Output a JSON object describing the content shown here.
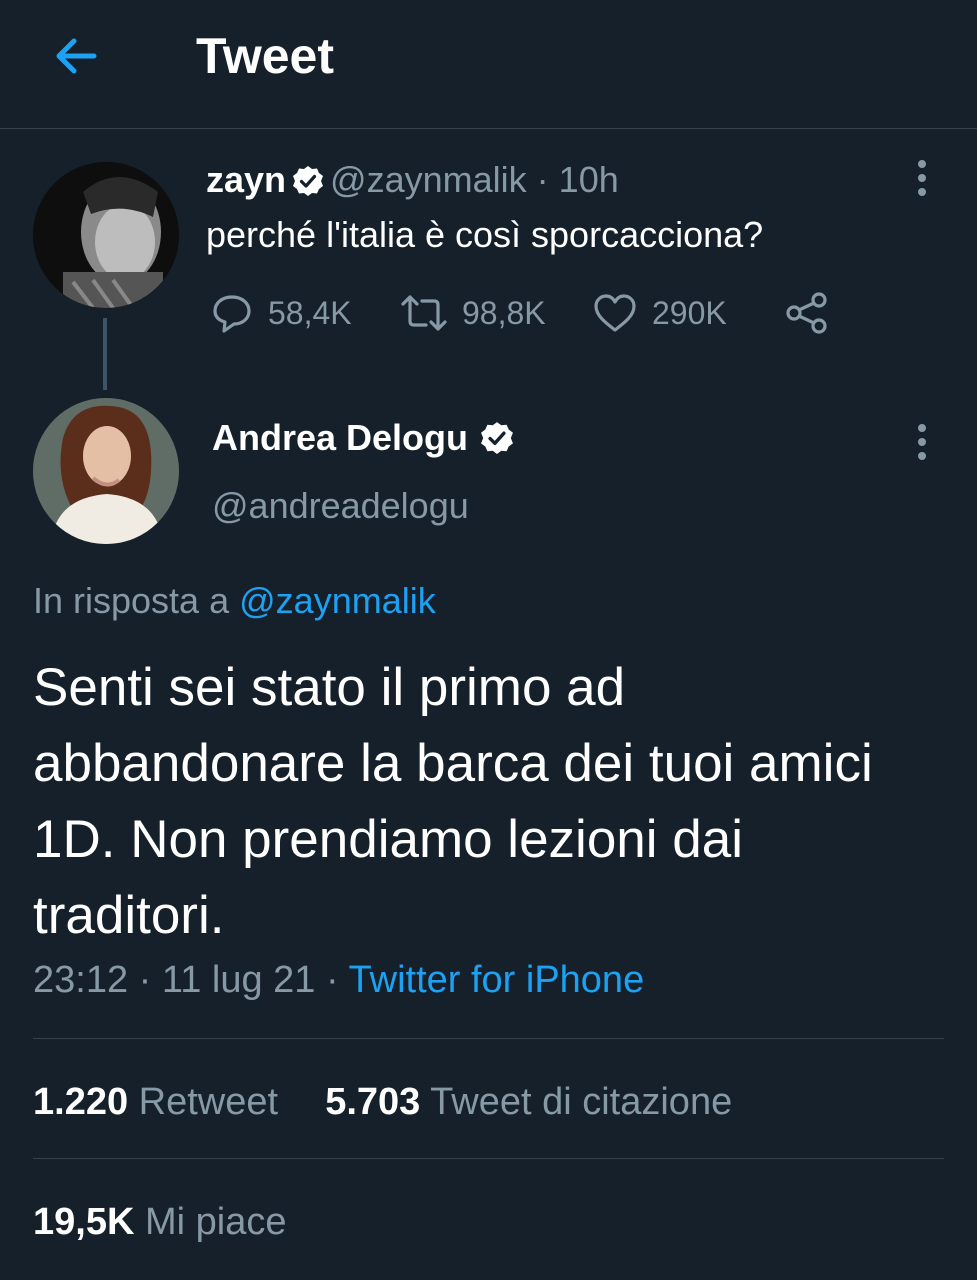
{
  "header": {
    "title": "Tweet"
  },
  "parent_tweet": {
    "name": "zayn",
    "handle": "@zaynmalik",
    "separator": "·",
    "time": "10h",
    "text": "perché l'italia è così sporcacciona?",
    "replies": "58,4K",
    "retweets": "98,8K",
    "likes": "290K"
  },
  "main_tweet": {
    "name": "Andrea Delogu",
    "handle": "@andreadelogu",
    "reply_prefix": "In risposta a",
    "reply_handle": "@zaynmalik",
    "text": "Senti sei stato il primo ad abbandonare la barca dei tuoi amici 1D. Non prendiamo lezioni dai traditori.",
    "time": "23:12",
    "sep1": "·",
    "date": "11 lug 21",
    "sep2": "·",
    "source": "Twitter for iPhone"
  },
  "stats": {
    "retweet_count": "1.220",
    "retweet_label": "Retweet",
    "quote_count": "5.703",
    "quote_label": "Tweet di citazione",
    "like_count": "19,5K",
    "like_label": "Mi piace"
  },
  "colors": {
    "background": "#15202b",
    "accent": "#1da1f2",
    "muted": "#8899a6",
    "divider": "#38444d"
  },
  "icons": {
    "back": "arrow-left-icon",
    "verified": "verified-badge-icon",
    "reply": "speech-bubble-icon",
    "retweet": "retweet-icon",
    "like": "heart-icon",
    "share": "share-icon",
    "more": "more-vertical-icon"
  }
}
